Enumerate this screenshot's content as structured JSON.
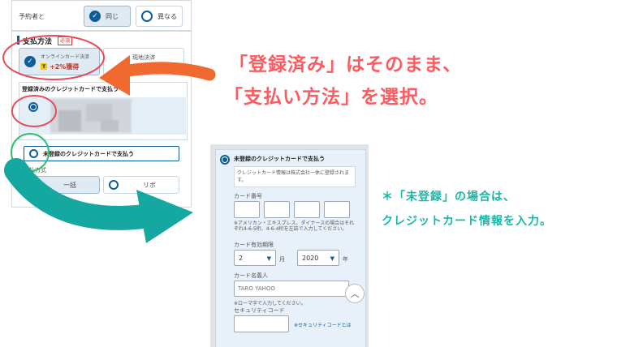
{
  "left_panel": {
    "booker_label": "予約者と",
    "booker_options": [
      "同じ",
      "異なる"
    ],
    "payment_title": "支払方法",
    "required_badge": "必須",
    "online_card_label": "オンラインカード決済",
    "points_text": "+2%獲得",
    "onsite_label": "現地決済",
    "registered_card_title": "登録済みのクレジットカードで支払う",
    "unregistered_card_label": "未登録のクレジットカードで支払う",
    "pay_method_label": "支払方式",
    "pay_method_options": [
      "一括",
      "リボ"
    ]
  },
  "right_panel": {
    "unregistered_title": "未登録のクレジットカードで支払う",
    "info_text": "クレジットカード情報は株式会社一休に登録されます。",
    "card_number_label": "カード番号",
    "card_number_note": "※アメリカン・エキスプレス、ダイナースの場合はそれぞれ4-6-5桁、4-6-4桁を左詰で入力してください。",
    "expiry_label": "カード有効期限",
    "expiry_month": "2",
    "month_unit": "月",
    "expiry_year": "2020",
    "year_unit": "年",
    "name_label": "カード名義人",
    "name_placeholder": "TARO YAHOO",
    "name_note": "※ローマ字で入力してください。",
    "security_label": "セキュリティコード",
    "security_link": "※セキュリティコードとは"
  },
  "annotations": {
    "line1": "「登録済み」はそのまま、",
    "line2": "「支払い方法」を選択。",
    "note1": "＊「未登録」の場合は、",
    "note2": "クレジットカード情報を入力。"
  },
  "colors": {
    "brand_blue": "#0d5d99",
    "annotation_red": "#ff5a5f",
    "annotation_teal": "#17b8a6",
    "arrow_orange": "#f0692f",
    "arrow_teal": "#14a8a0",
    "circle_red": "#e84a5a",
    "circle_green": "#2fbf6f"
  }
}
